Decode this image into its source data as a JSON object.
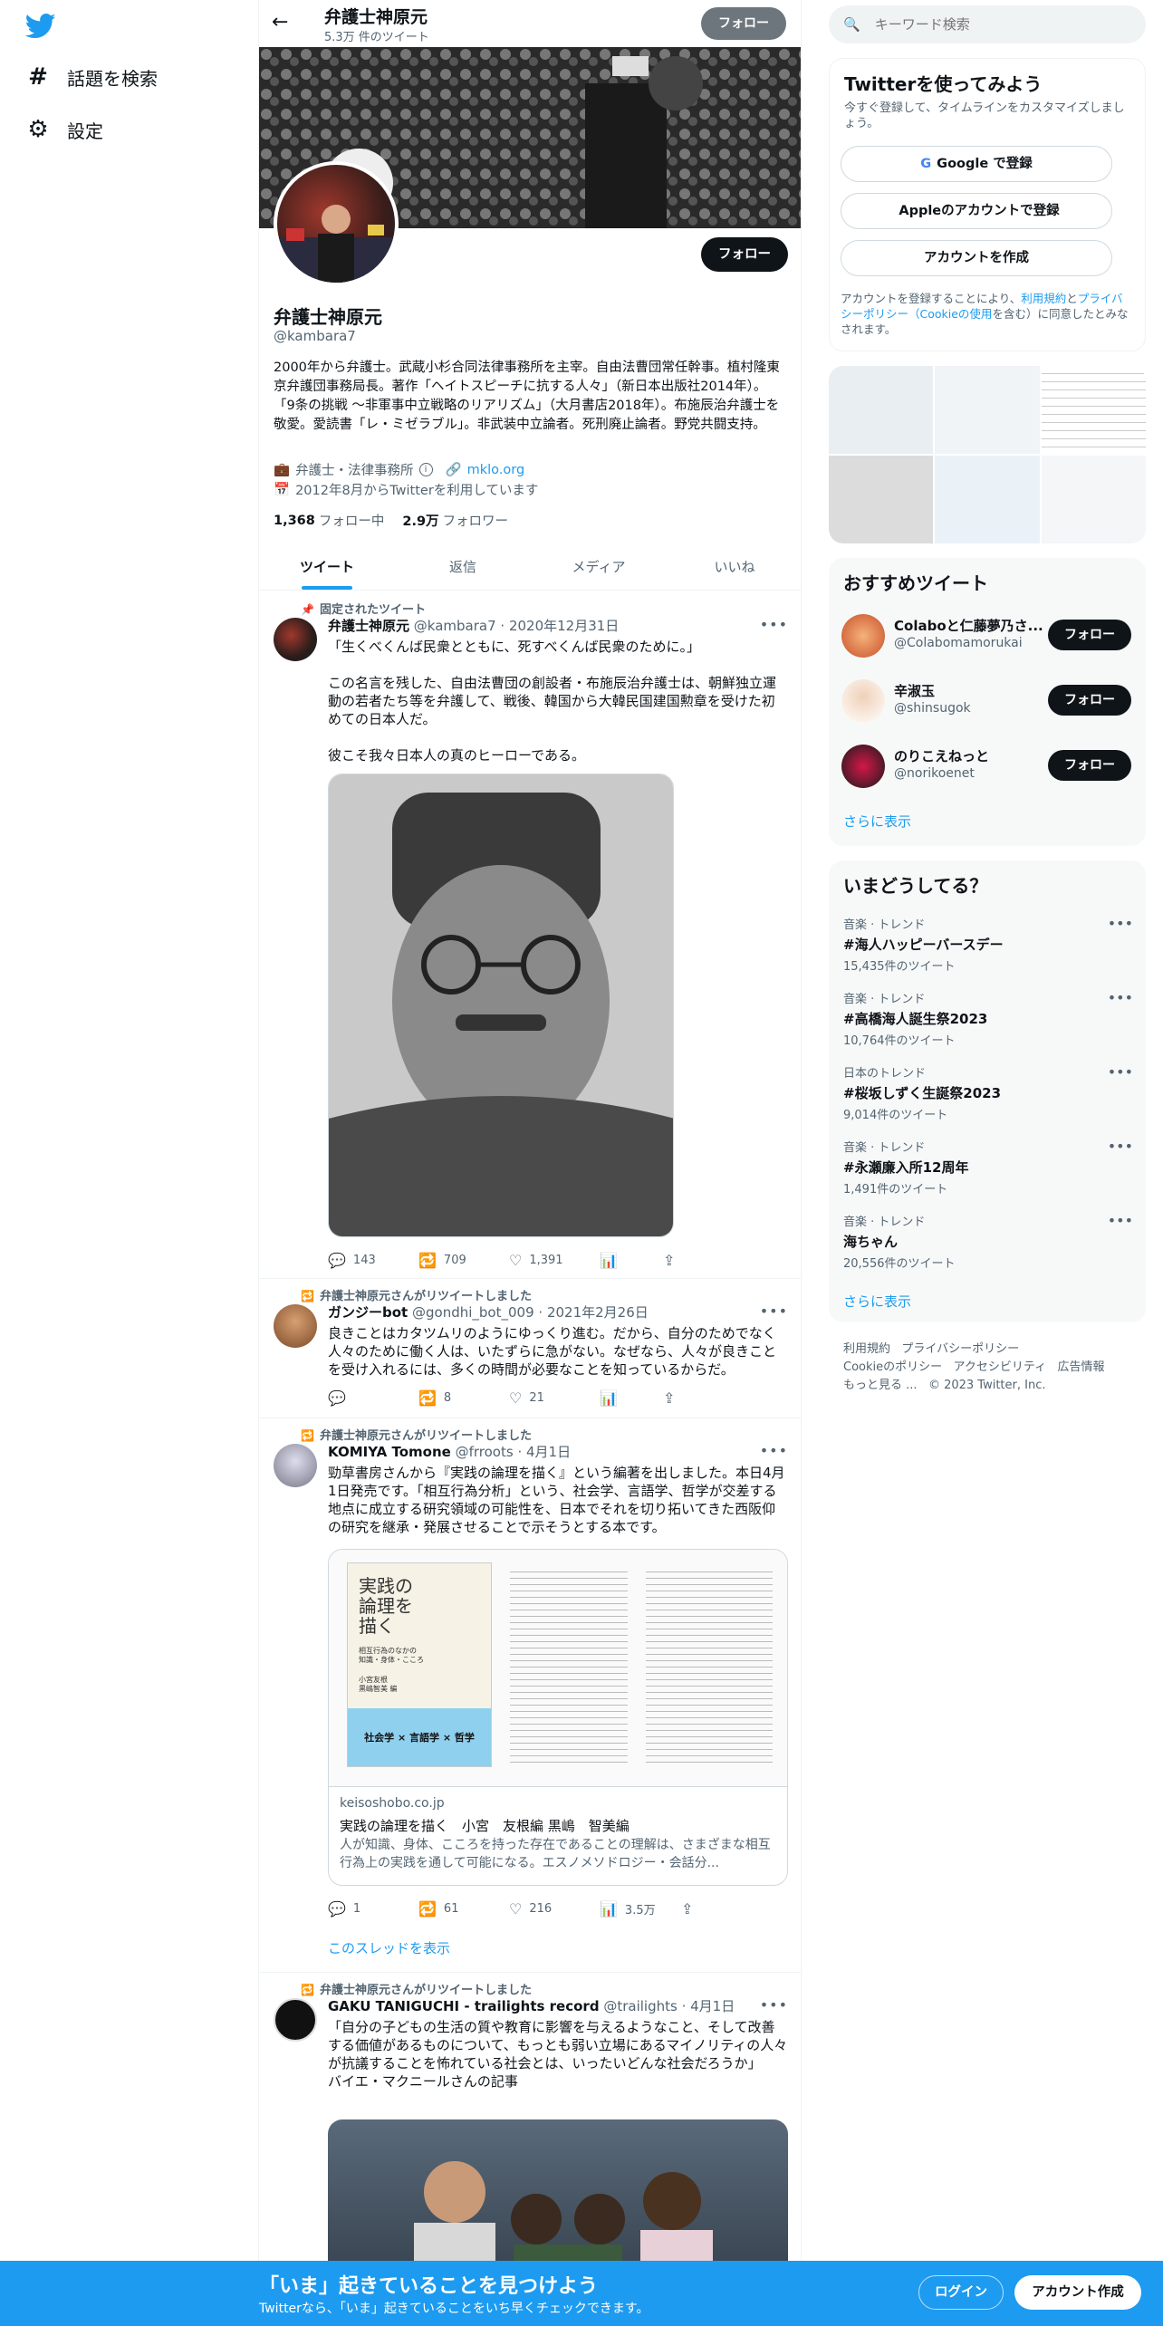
{
  "nav": {
    "explore_label": "話題を検索",
    "settings_label": "設定"
  },
  "header": {
    "name": "弁護士神原元",
    "tweet_count": "5.3万 件のツイート",
    "follow_label": "フォロー"
  },
  "profile": {
    "name": "弁護士神原元",
    "handle": "@kambara7",
    "bio": "2000年から弁護士。武蔵小杉合同法律事務所を主宰。自由法曹団常任幹事。植村隆東京弁護団事務局長。著作「ヘイトスピーチに抗する人々」（新日本出版社2014年）。「9条の挑戦 ～非軍事中立戦略のリアリズム」（大月書店2018年）。布施辰治弁護士を敬愛。愛読書「レ・ミゼラブル」。非武装中立論者。死刑廃止論者。野党共闘支持。",
    "category": "弁護士・法律事務所",
    "website": "mklo.org",
    "joined": "2012年8月からTwitterを利用しています",
    "following_count": "1,368",
    "following_label": "フォロー中",
    "followers_count": "2.9万",
    "followers_label": "フォロワー",
    "follow_label": "フォロー"
  },
  "tabs": [
    "ツイート",
    "返信",
    "メディア",
    "いいね"
  ],
  "tweets": [
    {
      "context": "固定されたツイート",
      "name": "弁護士神原元",
      "handle": "@kambara7",
      "date": "2020年12月31日",
      "text": "「生くべくんば民衆とともに、死すべくんば民衆のために。」\n\nこの名言を残した、自由法曹団の創設者・布施辰治弁護士は、朝鮮独立運動の若者たち等を弁護して、戦後、韓国から大韓民国建国勲章を受けた初めての日本人だ。\n\n彼こそ我々日本人の真のヒーローである。",
      "replies": "143",
      "retweets": "709",
      "likes": "1,391"
    },
    {
      "context": "弁護士神原元さんがリツイートしました",
      "name": "ガンジーbot",
      "handle": "@gondhi_bot_009",
      "date": "2021年2月26日",
      "text": "良きことはカタツムリのようにゆっくり進む。だから、自分のためでなく人々のために働く人は、いたずらに急がない。なぜなら、人々が良きことを受け入れるには、多くの時間が必要なことを知っているからだ。",
      "replies": "",
      "retweets": "8",
      "likes": "21"
    },
    {
      "context": "弁護士神原元さんがリツイートしました",
      "name": "KOMIYA Tomone",
      "handle": "@frroots",
      "date": "4月1日",
      "text": "勁草書房さんから『実践の論理を描く』という編著を出しました。本日4月1日発売です。「相互行為分析」という、社会学、言語学、哲学が交差する地点に成立する研究領域の可能性を、日本でそれを切り拓いてきた西阪仰の研究を継承・発展させることで示そうとする本です。",
      "card_domain": "keisoshobo.co.jp",
      "card_title": "実践の論理を描く　小宮　友根編 黒嶋　智美編",
      "card_desc": "人が知識、身体、こころを持った存在であることの理解は、さまざまな相互行為上の実践を通して可能になる。エスノメソドロジー・会話分...",
      "book_title": "実践の\n論理を\n描く",
      "book_sub": "相互行為のなかの\n知識・身体・こころ",
      "book_editors": "小宮友根\n黒嶋智美 編",
      "book_band": "社会学 × 言語学 × 哲学",
      "replies": "1",
      "retweets": "61",
      "likes": "216",
      "views": "3.5万",
      "thread_label": "このスレッドを表示"
    },
    {
      "context": "弁護士神原元さんがリツイートしました",
      "name": "GAKU TANIGUCHI - trailights record",
      "handle": "@trailights",
      "date": "4月1日",
      "text": "「自分の子どもの生活の質や教育に影響を与えるようなこと、そして改善する価値があるものについて、もっとも弱い立場にあるマイノリティの人々が抗議することを怖れている社会とは、いったいどんな社会だろうか」\nバイエ・マクニールさんの記事"
    }
  ],
  "sidebar": {
    "search_placeholder": "キーワード検索",
    "signup": {
      "title": "Twitterを使ってみよう",
      "subtitle": "今すぐ登録して、タイムラインをカスタマイズしましょう。",
      "google": "Google で登録",
      "apple": "Appleのアカウントで登録",
      "create": "アカウントを作成",
      "terms_prefix": "アカウントを登録することにより、",
      "terms_link1": "利用規約",
      "terms_and": "と",
      "terms_link2": "プライバシーポリシー（Cookieの使用",
      "terms_suffix": "を含む）に同意したとみなされます。"
    },
    "recommended": {
      "title": "おすすめツイート",
      "users": [
        {
          "name": "Colaboと仁藤夢乃さ...",
          "handle": "@Colabomamorukai",
          "follow": "フォロー"
        },
        {
          "name": "辛淑玉",
          "handle": "@shinsugok",
          "follow": "フォロー"
        },
        {
          "name": "のりこえねっと",
          "handle": "@norikoenet",
          "follow": "フォロー"
        }
      ],
      "more": "さらに表示"
    },
    "trends": {
      "title": "いまどうしてる？",
      "items": [
        {
          "category": "音楽 · トレンド",
          "name": "#海人ハッピーバースデー",
          "count": "15,435件のツイート"
        },
        {
          "category": "音楽 · トレンド",
          "name": "#高橋海人誕生祭2023",
          "count": "10,764件のツイート"
        },
        {
          "category": "日本のトレンド",
          "name": "#桜坂しずく生誕祭2023",
          "count": "9,014件のツイート"
        },
        {
          "category": "音楽 · トレンド",
          "name": "#永瀬廉入所12周年",
          "count": "1,491件のツイート"
        },
        {
          "category": "音楽 · トレンド",
          "name": "海ちゃん",
          "count": "20,556件のツイート"
        }
      ],
      "more": "さらに表示"
    },
    "footer": {
      "links": [
        "利用規約",
        "プライバシーポリシー",
        "Cookieのポリシー",
        "アクセシビリティ",
        "広告情報",
        "もっと見る ..."
      ],
      "copyright": "© 2023 Twitter, Inc."
    }
  },
  "bottom_bar": {
    "title": "「いま」起きていることを見つけよう",
    "subtitle": "Twitterなら、「いま」起きていることをいち早くチェックできます。",
    "login": "ログイン",
    "signup": "アカウント作成"
  },
  "colors": {
    "accent": "#1d9bf0",
    "text": "#0f1419",
    "muted": "#536471"
  }
}
